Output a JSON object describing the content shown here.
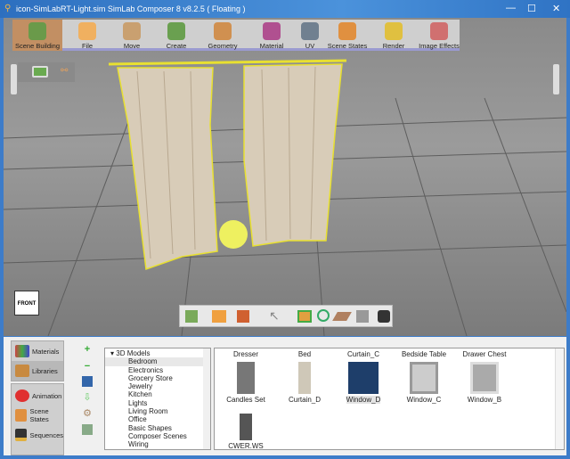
{
  "window": {
    "title": "icon-SimLabRT-Light.sim SimLab Composer 8 v8.2.5 ( Floating )",
    "minimize": "—",
    "maximize": "☐",
    "close": "✕"
  },
  "toolbar": [
    {
      "label": "Scene Building",
      "icon": "scene-building-icon",
      "color": "#6a9a4a"
    },
    {
      "label": "File",
      "icon": "folder-icon",
      "color": "#f0b060"
    },
    {
      "label": "Move",
      "icon": "move-icon",
      "color": "#c9a070"
    },
    {
      "label": "Create",
      "icon": "cube-icon",
      "color": "#6aa050"
    },
    {
      "label": "Geometry",
      "icon": "geometry-icon",
      "color": "#d09050"
    },
    {
      "label": "Material",
      "icon": "material-icon",
      "color": "#b05090"
    },
    {
      "label": "UV",
      "icon": "uv-icon",
      "color": "#708090"
    },
    {
      "label": "Scene States",
      "icon": "scene-states-icon",
      "color": "#e09040"
    },
    {
      "label": "Render",
      "icon": "render-icon",
      "color": "#e0c040"
    },
    {
      "label": "Image Effects",
      "icon": "image-effects-icon",
      "color": "#d07070"
    }
  ],
  "viewcube": {
    "label": "FRONT"
  },
  "side_panel": {
    "top": [
      "Materials",
      "Libraries"
    ],
    "bottom": [
      "Animation",
      "Scene States",
      "Sequences"
    ]
  },
  "tree": {
    "root": "3D Models",
    "items": [
      "Bedroom",
      "Electronics",
      "Grocery Store",
      "Jewelry",
      "Kitchen",
      "Lights",
      "Living Room",
      "Office",
      "Basic Shapes",
      "Composer Scenes",
      "Wiring"
    ],
    "selected": "Bedroom"
  },
  "library": {
    "header": [
      "Dresser",
      "Bed",
      "Curtain_C",
      "Bedside Table",
      "Drawer Chest"
    ],
    "items": [
      "Candles Set",
      "Curtain_D",
      "Window_D",
      "Window_C",
      "Window_B",
      "CWER.WS"
    ]
  }
}
